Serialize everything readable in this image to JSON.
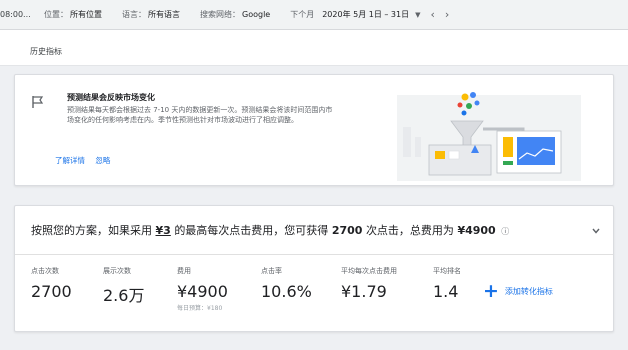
{
  "topbar": {
    "time": "08:00...",
    "location_label": "位置：",
    "location_value": "所有位置",
    "language_label": "语言：",
    "language_value": "所有语言",
    "network_label": "搜索网络：",
    "network_value": "Google",
    "period_label": "下个月",
    "period_value": "2020年 5月 1日 – 31日"
  },
  "strip": {
    "history": "历史指标"
  },
  "notice": {
    "title": "预测结果会反映市场变化",
    "body": "预测结果每天都会根据过去 7-10 天内的数据更新一次。预测结果会将该时间范围内市场变化的任何影响考虑在内。季节性预测也针对市场波动进行了相应调整。",
    "learn_more": "了解详情",
    "dismiss": "忽略"
  },
  "plan": {
    "summary_prefix": "按照您的方案，如果采用",
    "bid": "¥3",
    "summary_mid": "的最高每次点击费用，您可获得",
    "clicks": "2700",
    "summary_mid2": "次点击，总费用为",
    "cost": "¥4900",
    "help": "ⓘ",
    "metrics": [
      {
        "label": "点击次数",
        "value": "2700"
      },
      {
        "label": "展示次数",
        "value": "2.6万"
      },
      {
        "label": "费用",
        "value": "¥4900",
        "sub": "每日预算：¥180"
      },
      {
        "label": "点击率",
        "value": "10.6%"
      },
      {
        "label": "平均每次点击费用",
        "value": "¥1.79"
      },
      {
        "label": "平均排名",
        "value": "1.4"
      }
    ],
    "add_conversion": "添加转化指标"
  },
  "colors": {
    "accent": "#1a73e8",
    "yellow": "#fbbc04",
    "green": "#34a853",
    "red": "#ea4335"
  }
}
